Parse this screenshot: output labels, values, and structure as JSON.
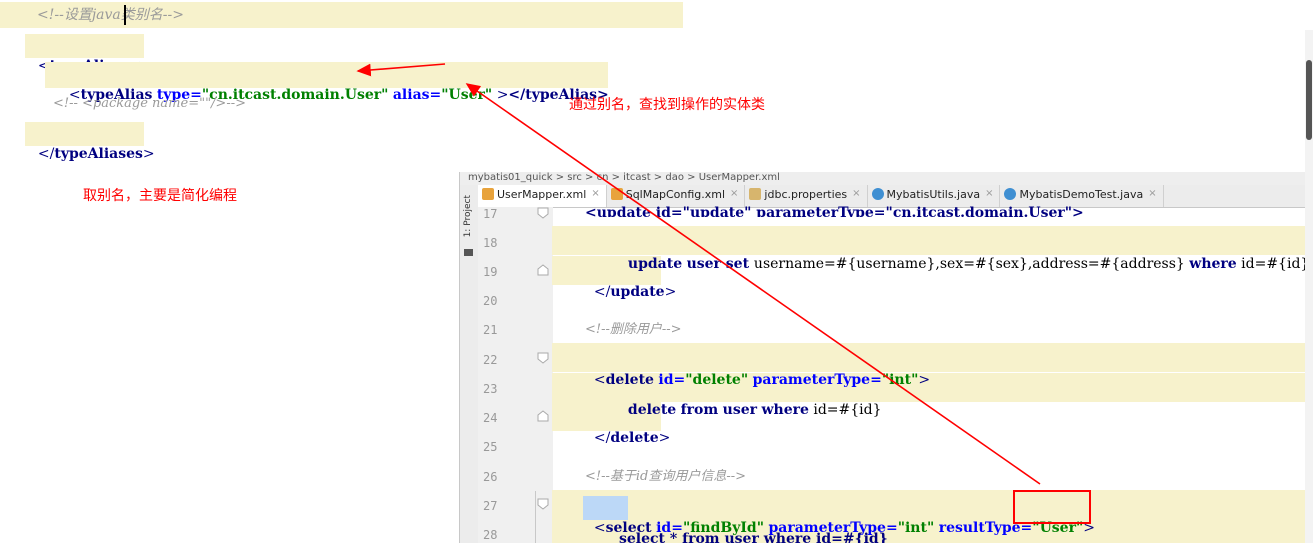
{
  "top_snippet": {
    "comment_line": "<!--设置java类别名-->",
    "open_tag": "typeAliases",
    "alias_tag": "typeAlias",
    "alias_type_attr": "type=",
    "alias_type_value": "\"cn.itcast.domain.User\"",
    "alias_alias_attr": "alias=",
    "alias_alias_value": "\"User\"",
    "alias_close": ">",
    "alias_close_tag": "</typeAlias>",
    "package_comment": "<!-- <package name=\"\"/>-->",
    "close_tag": "typeAliases"
  },
  "annotations": {
    "find_entity": "通过别名，查找到操作的实体类",
    "simplify": "取别名，主要是简化编程"
  },
  "ide": {
    "breadcrumb": "mybatis01_quick  >  src  >  cn  >  itcast  >  dao  >  UserMapper.xml",
    "sidebar_label": "1: Project",
    "tabs": [
      {
        "label": "UserMapper.xml",
        "icon": "xml-file-icon",
        "active": true
      },
      {
        "label": "SqlMapConfig.xml",
        "icon": "xml-file-icon",
        "active": false
      },
      {
        "label": "jdbc.properties",
        "icon": "properties-file-icon",
        "active": false
      },
      {
        "label": "MybatisUtils.java",
        "icon": "java-class-icon",
        "active": false
      },
      {
        "label": "MybatisDemoTest.java",
        "icon": "java-class-icon",
        "active": false
      }
    ],
    "line_numbers": [
      "17",
      "18",
      "19",
      "20",
      "21",
      "22",
      "23",
      "24",
      "25",
      "26",
      "27",
      "28"
    ],
    "code": {
      "l17": "<update id=\"update\" parameterType=\"cn.itcast.domain.User\">",
      "l18_kw1": "update",
      "l18_kw2": "user",
      "l18_set": " set ",
      "l18_rest": "username=#{username},sex=#{sex},address=#{address} ",
      "l18_where": "where",
      "l18_tail": " id=#{id}",
      "l19": "update",
      "l21": "<!--删除用户-->",
      "l22_tag": "delete",
      "l22_id_attr": "id=",
      "l22_id_val": "\"delete\"",
      "l22_pt_attr": "parameterType=",
      "l22_pt_val": "\"int\"",
      "l23_delete": "delete",
      "l23_from": "from",
      "l23_user": "user",
      "l23_where": "where",
      "l23_tail": " id=#{id}",
      "l24": "delete",
      "l26": "<!--基于id查询用户信息-->",
      "l27_tag": "select",
      "l27_id_attr": "id=",
      "l27_id_val": "\"findById\"",
      "l27_pt_attr": "parameterType=",
      "l27_pt_val": "\"int\"",
      "l27_rt_attr": "resultType=",
      "l27_rt_val": "\"User\"",
      "l28": "select * from user where id=#{id}"
    }
  },
  "colors": {
    "annotation_red": "#ff0000",
    "highlight_yellow": "#f7f2cc",
    "xml_tag_navy": "#000080",
    "xml_attr_blue": "#0000ff",
    "xml_string_green": "#008000"
  }
}
